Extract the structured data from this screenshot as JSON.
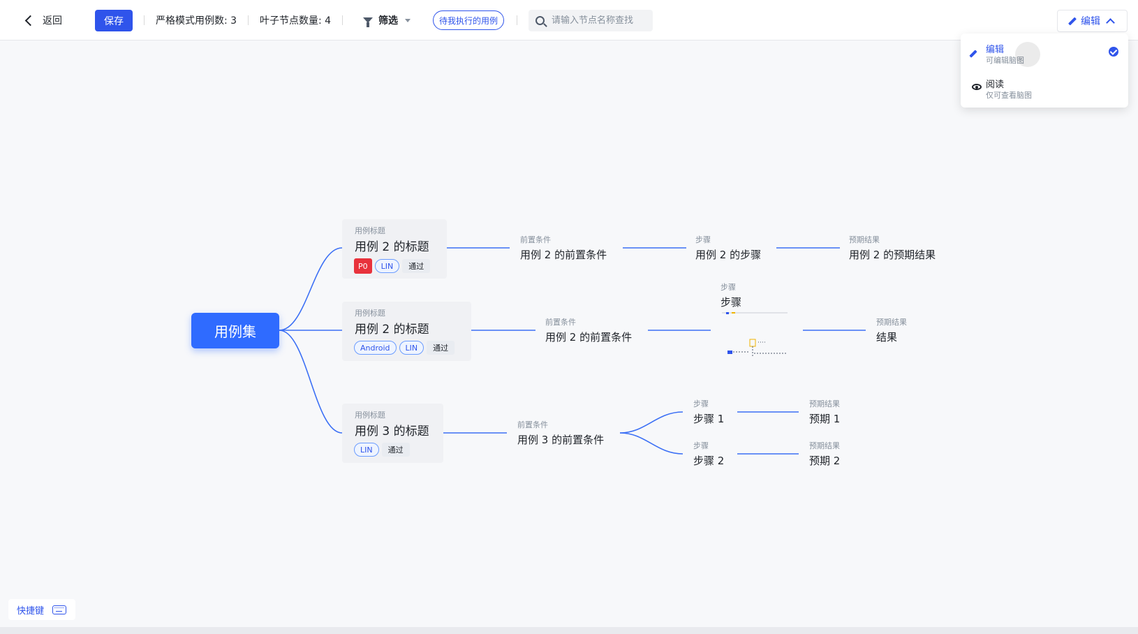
{
  "toolbar": {
    "back_label": "返回",
    "save_label": "保存",
    "strict_cases": "严格模式用例数: 3",
    "leaf_count": "叶子节点数量: 4",
    "filter_label": "筛选",
    "pending_label": "待我执行的用例",
    "search_placeholder": "请输入节点名称查找",
    "mode_label": "编辑"
  },
  "mode_menu": {
    "items": [
      {
        "title": "编辑",
        "desc": "可编辑脑图",
        "icon": "pencil-icon",
        "selected": true
      },
      {
        "title": "阅读",
        "desc": "仅可查看脑图",
        "icon": "eye-icon",
        "selected": false
      }
    ]
  },
  "mindmap": {
    "root": "用例集",
    "cases": [
      {
        "caption": "用例标题",
        "title": "用例 2 的标题",
        "tags": [
          "P0",
          "LIN",
          "通过"
        ],
        "precondition": {
          "caption": "前置条件",
          "text": "用例 2 的前置条件"
        },
        "step": {
          "caption": "步骤",
          "text": "用例 2 的步骤"
        },
        "result": {
          "caption": "预期结果",
          "text": "用例 2 的预期结果"
        }
      },
      {
        "caption": "用例标题",
        "title": "用例 2 的标题",
        "tags": [
          "Android",
          "LIN",
          "通过"
        ],
        "precondition": {
          "caption": "前置条件",
          "text": "用例 2 的前置条件"
        },
        "step": {
          "caption": "步骤",
          "text": "步骤"
        },
        "result": {
          "caption": "预期结果",
          "text": "结果"
        }
      },
      {
        "caption": "用例标题",
        "title": "用例 3 的标题",
        "tags": [
          "LIN",
          "通过"
        ],
        "precondition": {
          "caption": "前置条件",
          "text": "用例 3 的前置条件"
        },
        "steps": [
          {
            "caption": "步骤",
            "text": "步骤 1",
            "result_caption": "预期结果",
            "result": "预期 1"
          },
          {
            "caption": "步骤",
            "text": "步骤 2",
            "result_caption": "预期结果",
            "result": "预期 2"
          }
        ]
      }
    ]
  },
  "shortcut_label": "快捷键",
  "colors": {
    "accent": "#2f54eb",
    "root": "#2f6bff",
    "priority": "#e8323c",
    "link": "#3b6ff5"
  }
}
